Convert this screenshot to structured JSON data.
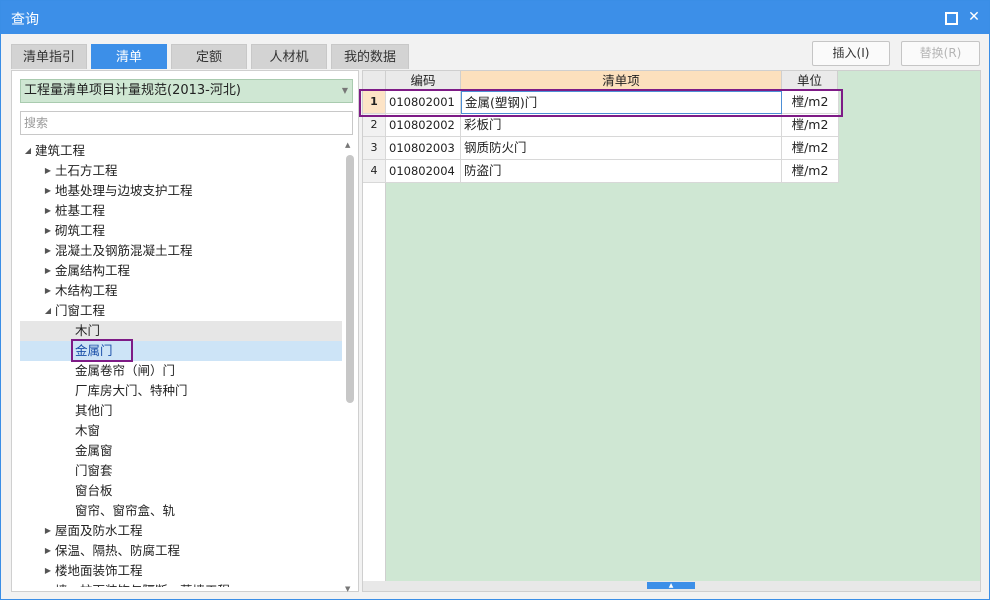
{
  "window": {
    "title": "查询",
    "maximize_icon": "maximize-icon",
    "close_icon": "close-icon",
    "close_glyph": "✕"
  },
  "tabs": [
    "清单指引",
    "清单",
    "定额",
    "人材机",
    "我的数据"
  ],
  "active_tab": "清单",
  "toolbar": {
    "insert_label": "插入(I)",
    "replace_label": "替换(R)"
  },
  "left": {
    "spec_select": "工程量清单项目计量规范(2013-河北)",
    "search_placeholder": "搜索",
    "tree": [
      {
        "label": "建筑工程",
        "level": 0,
        "expanded": true
      },
      {
        "label": "土石方工程",
        "level": 1,
        "expanded": false
      },
      {
        "label": "地基处理与边坡支护工程",
        "level": 1,
        "expanded": false
      },
      {
        "label": "桩基工程",
        "level": 1,
        "expanded": false
      },
      {
        "label": "砌筑工程",
        "level": 1,
        "expanded": false
      },
      {
        "label": "混凝土及钢筋混凝土工程",
        "level": 1,
        "expanded": false
      },
      {
        "label": "金属结构工程",
        "level": 1,
        "expanded": false
      },
      {
        "label": "木结构工程",
        "level": 1,
        "expanded": false
      },
      {
        "label": "门窗工程",
        "level": 1,
        "expanded": true
      },
      {
        "label": "木门",
        "level": 2
      },
      {
        "label": "金属门",
        "level": 2
      },
      {
        "label": "金属卷帘（闸）门",
        "level": 2
      },
      {
        "label": "厂库房大门、特种门",
        "level": 2
      },
      {
        "label": "其他门",
        "level": 2
      },
      {
        "label": "木窗",
        "level": 2
      },
      {
        "label": "金属窗",
        "level": 2
      },
      {
        "label": "门窗套",
        "level": 2
      },
      {
        "label": "窗台板",
        "level": 2
      },
      {
        "label": "窗帘、窗帘盒、轨",
        "level": 2
      },
      {
        "label": "屋面及防水工程",
        "level": 1,
        "expanded": false
      },
      {
        "label": "保温、隔热、防腐工程",
        "level": 1,
        "expanded": false
      },
      {
        "label": "楼地面装饰工程",
        "level": 1,
        "expanded": false
      },
      {
        "label": "墙、柱面装饰与隔断、幕墙工程",
        "level": 1,
        "expanded": false
      }
    ],
    "hover_item": "木门",
    "selected_item": "金属门"
  },
  "grid": {
    "columns": [
      "编码",
      "清单项",
      "单位"
    ],
    "active_column": "清单项",
    "rows": [
      {
        "num": "1",
        "code": "010802001",
        "name": "金属(塑钢)门",
        "unit": "樘/m2"
      },
      {
        "num": "2",
        "code": "010802002",
        "name": "彩板门",
        "unit": "樘/m2"
      },
      {
        "num": "3",
        "code": "010802003",
        "name": "钢质防火门",
        "unit": "樘/m2"
      },
      {
        "num": "4",
        "code": "010802004",
        "name": "防盗门",
        "unit": "樘/m2"
      }
    ],
    "current_row": "1"
  },
  "colors": {
    "accent": "#3c8fe8",
    "grid_bg": "#cfe7d3",
    "highlight_box": "#7e1b86"
  }
}
